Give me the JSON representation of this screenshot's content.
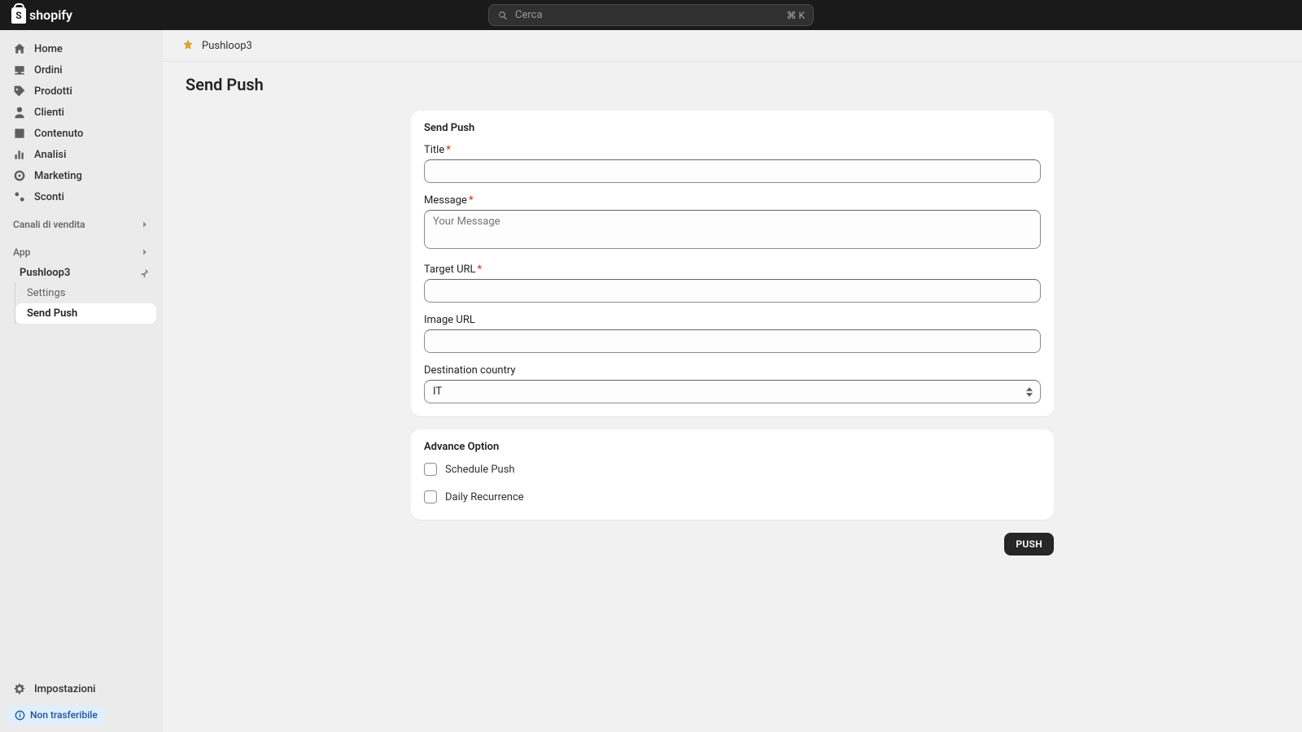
{
  "brand": "shopify",
  "search": {
    "placeholder": "Cerca",
    "shortcut": "⌘ K"
  },
  "nav": {
    "home": "Home",
    "orders": "Ordini",
    "products": "Prodotti",
    "customers": "Clienti",
    "content": "Contenuto",
    "analytics": "Analisi",
    "marketing": "Marketing",
    "discounts": "Sconti"
  },
  "sections": {
    "channels": "Canali di vendita",
    "apps": "App"
  },
  "app": {
    "name": "Pushloop3",
    "sub": {
      "settings": "Settings",
      "sendpush": "Send Push"
    }
  },
  "settings_label": "Impostazioni",
  "pill": "Non trasferibile",
  "crumb": "Pushloop3",
  "page_title": "Send Push",
  "form": {
    "heading": "Send Push",
    "title_label": "Title",
    "message_label": "Message",
    "message_placeholder": "Your Message",
    "target_label": "Target URL",
    "image_label": "Image URL",
    "country_label": "Destination country",
    "country_value": "IT"
  },
  "advanced": {
    "heading": "Advance Option",
    "schedule": "Schedule Push",
    "recurrence": "Daily Recurrence"
  },
  "push_button": "PUSH"
}
